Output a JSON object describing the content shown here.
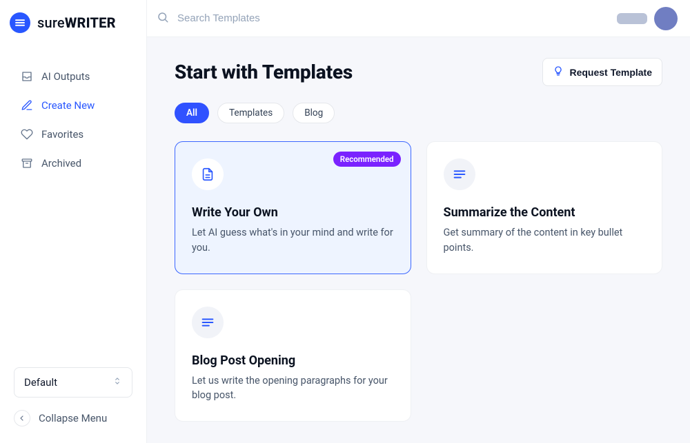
{
  "brand": {
    "pre": "sure",
    "bold": "WRITER"
  },
  "sidebar": {
    "items": [
      {
        "label": "AI Outputs",
        "icon": "inbox-icon",
        "active": false
      },
      {
        "label": "Create New",
        "icon": "edit-icon",
        "active": true
      },
      {
        "label": "Favorites",
        "icon": "heart-icon",
        "active": false
      },
      {
        "label": "Archived",
        "icon": "archive-icon",
        "active": false
      }
    ],
    "select_value": "Default",
    "collapse_label": "Collapse Menu"
  },
  "search": {
    "placeholder": "Search Templates"
  },
  "page": {
    "title": "Start with Templates",
    "request_label": "Request Template"
  },
  "filters": [
    {
      "label": "All",
      "active": true
    },
    {
      "label": "Templates",
      "active": false
    },
    {
      "label": "Blog",
      "active": false
    }
  ],
  "cards": [
    {
      "title": "Write Your Own",
      "desc": "Let AI guess what's in your mind and write for you.",
      "icon": "file-icon",
      "selected": true,
      "badge": "Recommended"
    },
    {
      "title": "Summarize the Content",
      "desc": "Get summary of the content in key bullet points.",
      "icon": "lines-icon",
      "selected": false
    },
    {
      "title": "Blog Post Opening",
      "desc": "Let us write the opening paragraphs for your blog post.",
      "icon": "lines-icon",
      "selected": false
    }
  ]
}
